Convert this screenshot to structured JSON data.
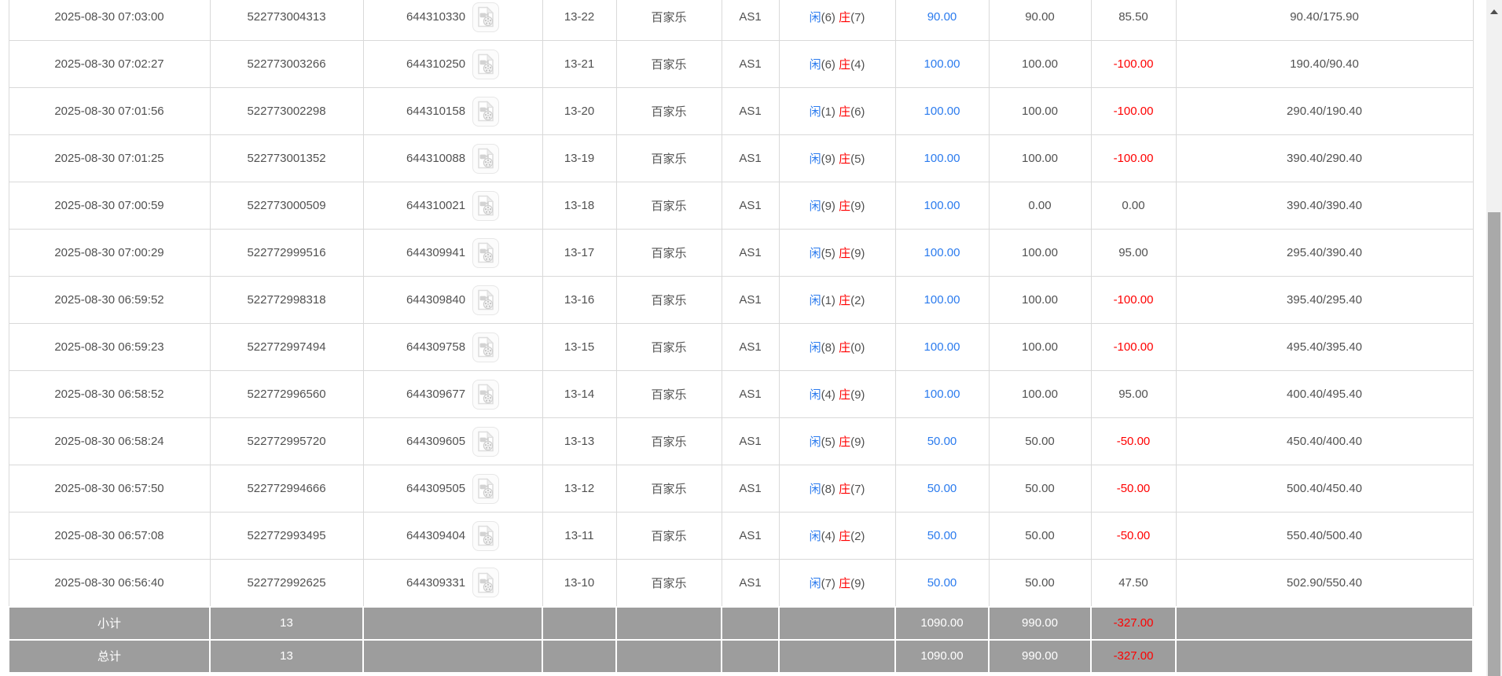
{
  "colors": {
    "blue": "#2b7bee",
    "red": "#ff0000",
    "text": "#515151",
    "border": "#d9d9d9",
    "summary_bg": "#9d9d9d",
    "summary_text": "#ffffff",
    "scrollbar_track": "#f1f1f1",
    "scrollbar_thumb": "#a9a9a9"
  },
  "bets": {
    "rows": [
      {
        "time": "2025-08-30 07:03:00",
        "order_no": "522773004313",
        "round_no": "644310330",
        "shoe_round": "13-22",
        "game": "百家乐",
        "table": "AS1",
        "player": "闲",
        "player_score": "(6)",
        "banker": "庄",
        "banker_score": "(7)",
        "bet": "90.00",
        "valid": "90.00",
        "winloss": "85.50",
        "balance": "90.40/175.90"
      },
      {
        "time": "2025-08-30 07:02:27",
        "order_no": "522773003266",
        "round_no": "644310250",
        "shoe_round": "13-21",
        "game": "百家乐",
        "table": "AS1",
        "player": "闲",
        "player_score": "(6)",
        "banker": "庄",
        "banker_score": "(4)",
        "bet": "100.00",
        "valid": "100.00",
        "winloss": "-100.00",
        "balance": "190.40/90.40"
      },
      {
        "time": "2025-08-30 07:01:56",
        "order_no": "522773002298",
        "round_no": "644310158",
        "shoe_round": "13-20",
        "game": "百家乐",
        "table": "AS1",
        "player": "闲",
        "player_score": "(1)",
        "banker": "庄",
        "banker_score": "(6)",
        "bet": "100.00",
        "valid": "100.00",
        "winloss": "-100.00",
        "balance": "290.40/190.40"
      },
      {
        "time": "2025-08-30 07:01:25",
        "order_no": "522773001352",
        "round_no": "644310088",
        "shoe_round": "13-19",
        "game": "百家乐",
        "table": "AS1",
        "player": "闲",
        "player_score": "(9)",
        "banker": "庄",
        "banker_score": "(5)",
        "bet": "100.00",
        "valid": "100.00",
        "winloss": "-100.00",
        "balance": "390.40/290.40"
      },
      {
        "time": "2025-08-30 07:00:59",
        "order_no": "522773000509",
        "round_no": "644310021",
        "shoe_round": "13-18",
        "game": "百家乐",
        "table": "AS1",
        "player": "闲",
        "player_score": "(9)",
        "banker": "庄",
        "banker_score": "(9)",
        "bet": "100.00",
        "valid": "0.00",
        "winloss": "0.00",
        "balance": "390.40/390.40"
      },
      {
        "time": "2025-08-30 07:00:29",
        "order_no": "522772999516",
        "round_no": "644309941",
        "shoe_round": "13-17",
        "game": "百家乐",
        "table": "AS1",
        "player": "闲",
        "player_score": "(5)",
        "banker": "庄",
        "banker_score": "(9)",
        "bet": "100.00",
        "valid": "100.00",
        "winloss": "95.00",
        "balance": "295.40/390.40"
      },
      {
        "time": "2025-08-30 06:59:52",
        "order_no": "522772998318",
        "round_no": "644309840",
        "shoe_round": "13-16",
        "game": "百家乐",
        "table": "AS1",
        "player": "闲",
        "player_score": "(1)",
        "banker": "庄",
        "banker_score": "(2)",
        "bet": "100.00",
        "valid": "100.00",
        "winloss": "-100.00",
        "balance": "395.40/295.40"
      },
      {
        "time": "2025-08-30 06:59:23",
        "order_no": "522772997494",
        "round_no": "644309758",
        "shoe_round": "13-15",
        "game": "百家乐",
        "table": "AS1",
        "player": "闲",
        "player_score": "(8)",
        "banker": "庄",
        "banker_score": "(0)",
        "bet": "100.00",
        "valid": "100.00",
        "winloss": "-100.00",
        "balance": "495.40/395.40"
      },
      {
        "time": "2025-08-30 06:58:52",
        "order_no": "522772996560",
        "round_no": "644309677",
        "shoe_round": "13-14",
        "game": "百家乐",
        "table": "AS1",
        "player": "闲",
        "player_score": "(4)",
        "banker": "庄",
        "banker_score": "(9)",
        "bet": "100.00",
        "valid": "100.00",
        "winloss": "95.00",
        "balance": "400.40/495.40"
      },
      {
        "time": "2025-08-30 06:58:24",
        "order_no": "522772995720",
        "round_no": "644309605",
        "shoe_round": "13-13",
        "game": "百家乐",
        "table": "AS1",
        "player": "闲",
        "player_score": "(5)",
        "banker": "庄",
        "banker_score": "(9)",
        "bet": "50.00",
        "valid": "50.00",
        "winloss": "-50.00",
        "balance": "450.40/400.40"
      },
      {
        "time": "2025-08-30 06:57:50",
        "order_no": "522772994666",
        "round_no": "644309505",
        "shoe_round": "13-12",
        "game": "百家乐",
        "table": "AS1",
        "player": "闲",
        "player_score": "(8)",
        "banker": "庄",
        "banker_score": "(7)",
        "bet": "50.00",
        "valid": "50.00",
        "winloss": "-50.00",
        "balance": "500.40/450.40"
      },
      {
        "time": "2025-08-30 06:57:08",
        "order_no": "522772993495",
        "round_no": "644309404",
        "shoe_round": "13-11",
        "game": "百家乐",
        "table": "AS1",
        "player": "闲",
        "player_score": "(4)",
        "banker": "庄",
        "banker_score": "(2)",
        "bet": "50.00",
        "valid": "50.00",
        "winloss": "-50.00",
        "balance": "550.40/500.40"
      },
      {
        "time": "2025-08-30 06:56:40",
        "order_no": "522772992625",
        "round_no": "644309331",
        "shoe_round": "13-10",
        "game": "百家乐",
        "table": "AS1",
        "player": "闲",
        "player_score": "(7)",
        "banker": "庄",
        "banker_score": "(9)",
        "bet": "50.00",
        "valid": "50.00",
        "winloss": "47.50",
        "balance": "502.90/550.40"
      }
    ],
    "subtotal": {
      "label": "小计",
      "count": "13",
      "bet": "1090.00",
      "valid": "990.00",
      "winloss": "-327.00"
    },
    "total": {
      "label": "总计",
      "count": "13",
      "bet": "1090.00",
      "valid": "990.00",
      "winloss": "-327.00"
    }
  }
}
